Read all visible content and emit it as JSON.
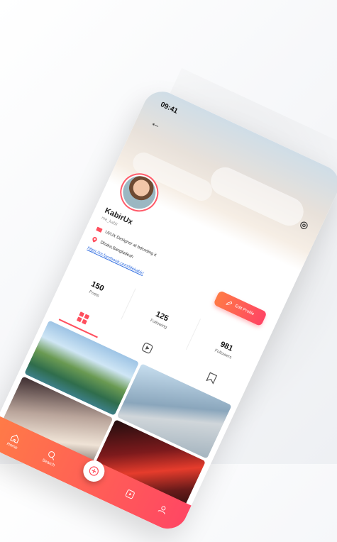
{
  "status": {
    "time": "09:41"
  },
  "profile": {
    "name": "KabirUx",
    "handle": "me_kabir",
    "bio_role": "UI/UX Designer at bdcoding it",
    "location": "Dhaka,Bangladesh",
    "link": "https://m.facebook.com/Mekabir/"
  },
  "actions": {
    "edit_profile": "Edit Profile"
  },
  "stats": [
    {
      "value": "150",
      "label": "Posts"
    },
    {
      "value": "125",
      "label": "Following"
    },
    {
      "value": "981",
      "label": "Followers"
    }
  ],
  "tabs": [
    {
      "icon": "grid-icon",
      "active": true
    },
    {
      "icon": "video-icon",
      "active": false
    },
    {
      "icon": "bookmark-icon",
      "active": false
    }
  ],
  "bottom_nav": [
    {
      "label": "Home",
      "icon": "home-icon"
    },
    {
      "label": "Search",
      "icon": "search-icon"
    },
    {
      "label": "",
      "icon": "add-icon"
    },
    {
      "label": "",
      "icon": "reels-icon"
    },
    {
      "label": "",
      "icon": "profile-icon"
    }
  ],
  "colors": {
    "accent_start": "#ff7b47",
    "accent_end": "#ff4763",
    "link": "#2d6be0"
  }
}
